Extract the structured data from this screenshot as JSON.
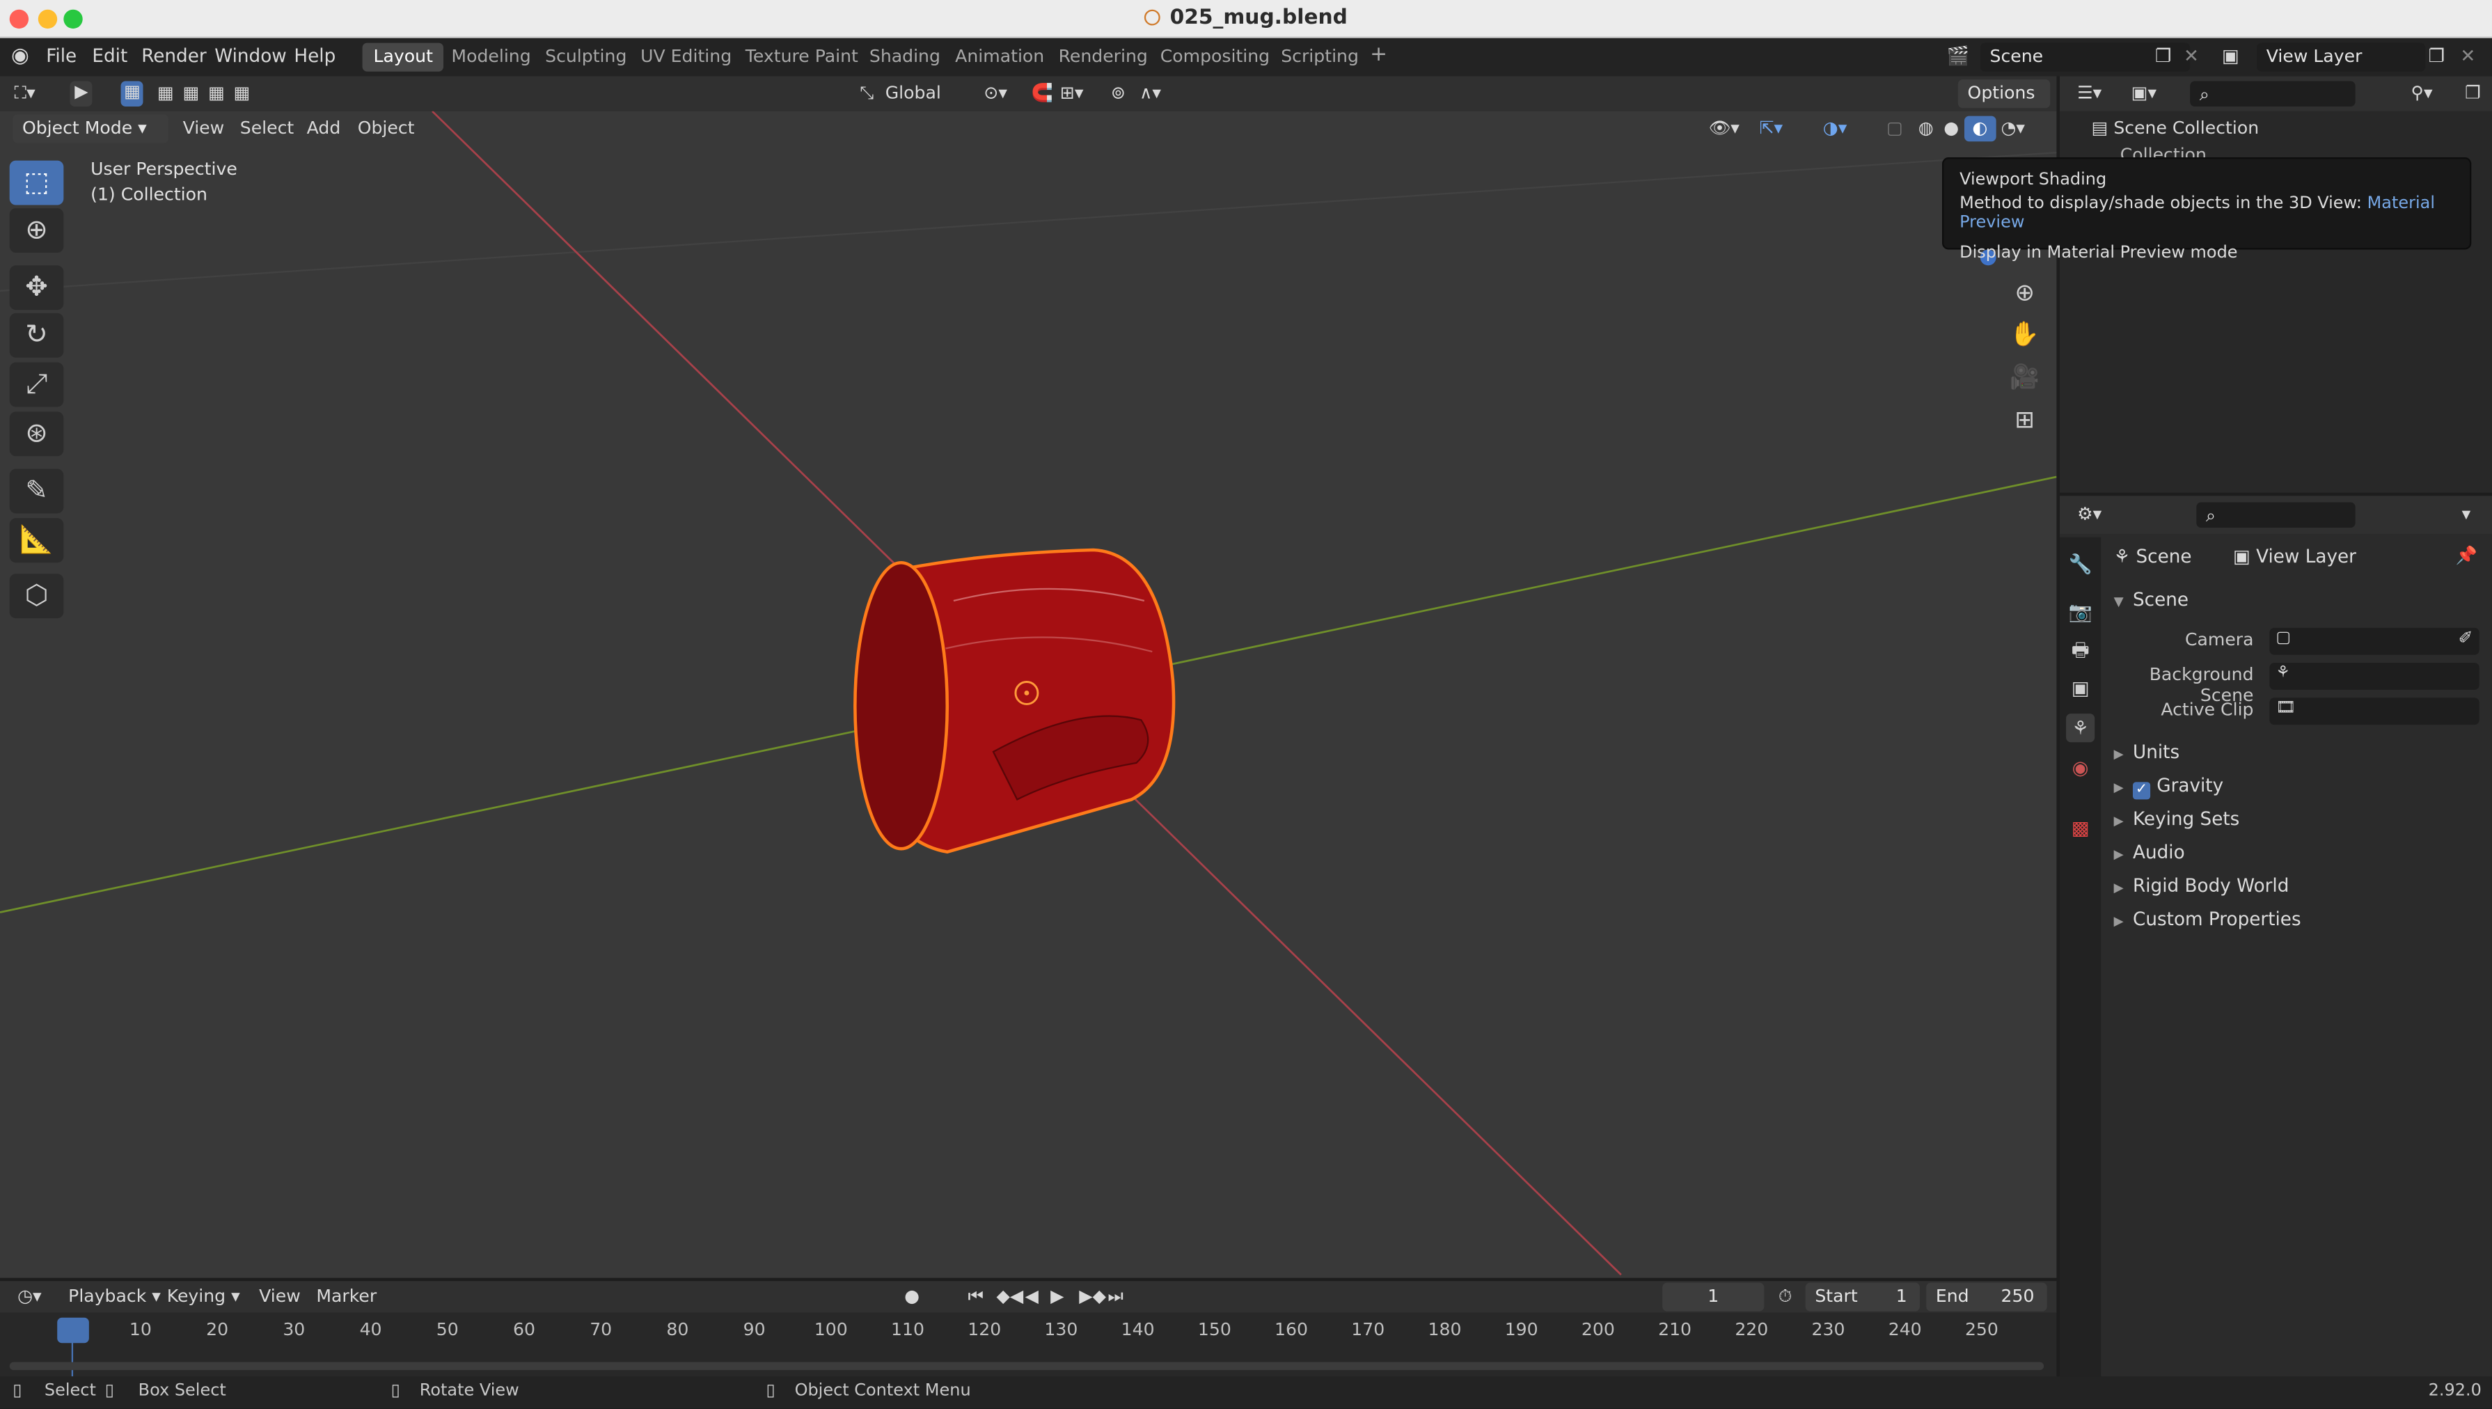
{
  "window": {
    "title": "025_mug.blend"
  },
  "menu": [
    "File",
    "Edit",
    "Render",
    "Window",
    "Help"
  ],
  "workspaces": [
    "Layout",
    "Modeling",
    "Sculpting",
    "UV Editing",
    "Texture Paint",
    "Shading",
    "Animation",
    "Rendering",
    "Compositing",
    "Scripting"
  ],
  "scene_field": "Scene",
  "viewlayer_field": "View Layer",
  "viewport": {
    "mode": "Object Mode",
    "menus": [
      "View",
      "Select",
      "Add",
      "Object"
    ],
    "transform": "Global",
    "options": "Options",
    "info_line1": "User Perspective",
    "info_line2": "(1) Collection"
  },
  "tooltip": {
    "title": "Viewport Shading",
    "desc": "Method to display/shade objects in the 3D View:",
    "value": "Material Preview",
    "sub": "Display in Material Preview mode"
  },
  "outliner": {
    "scene_collection": "Scene Collection",
    "collection": "Collection"
  },
  "properties": {
    "breadcrumb_scene": "Scene",
    "breadcrumb_viewlayer": "View Layer",
    "section": "Scene",
    "camera_label": "Camera",
    "bgscene_label": "Background Scene",
    "activeclip_label": "Active Clip",
    "panels": [
      "Units",
      "Gravity",
      "Keying Sets",
      "Audio",
      "Rigid Body World",
      "Custom Properties"
    ]
  },
  "timeline": {
    "menus": [
      "Playback",
      "Keying",
      "View",
      "Marker"
    ],
    "current_frame": "1",
    "start_label": "Start",
    "start": "1",
    "end_label": "End",
    "end": "250",
    "ticks": [
      "1",
      "10",
      "20",
      "30",
      "40",
      "50",
      "60",
      "70",
      "80",
      "90",
      "100",
      "110",
      "120",
      "130",
      "140",
      "150",
      "160",
      "170",
      "180",
      "190",
      "200",
      "210",
      "220",
      "230",
      "240",
      "250"
    ]
  },
  "status": {
    "select": "Select",
    "box_select": "Box Select",
    "rotate": "Rotate View",
    "context": "Object Context Menu",
    "version": "2.92.0"
  },
  "colors": {
    "accent": "#4772b3",
    "mug": "#a50f12",
    "selection": "#ff7b1a"
  }
}
